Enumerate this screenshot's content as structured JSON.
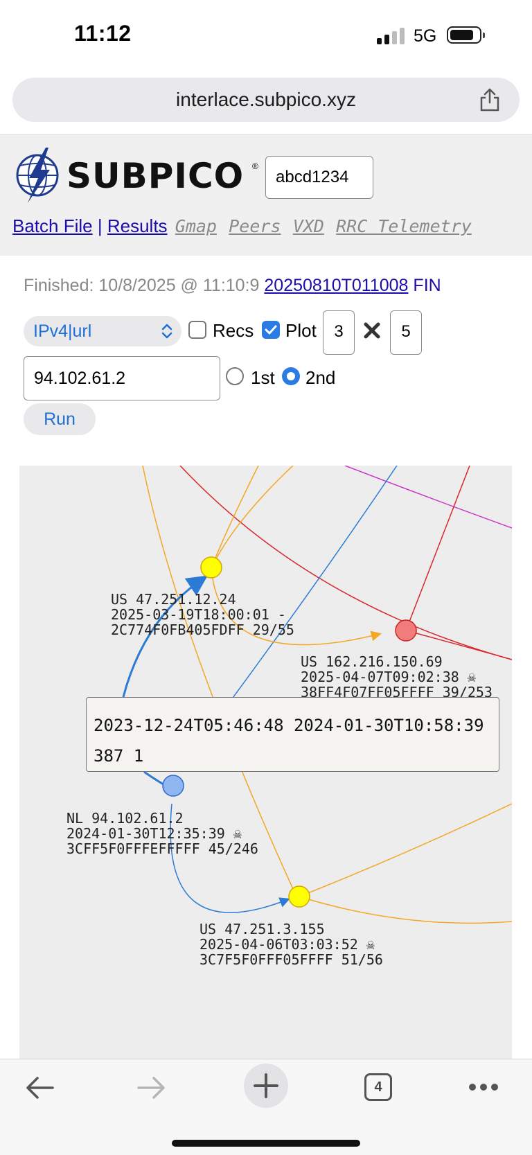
{
  "status_bar": {
    "time": "11:12",
    "network": "5G"
  },
  "browser": {
    "url": "interlace.subpico.xyz",
    "tab_count": "4"
  },
  "header": {
    "logo_text": "SUBPICO",
    "logo_reg": "®",
    "session_id": "abcd1234",
    "nav": {
      "batch_file": "Batch File",
      "separator": "|",
      "results": "Results",
      "gmap": "Gmap",
      "peers": "Peers",
      "vxd": "VXD",
      "rrc_telemetry": "RRC Telemetry"
    }
  },
  "controls": {
    "finished_label": "Finished: 10/8/2025 @ 11:10:9",
    "run_id": "20250810T011008",
    "fin": "FIN",
    "select_value": "IPv4|url",
    "recs_label": "Recs",
    "recs_checked": false,
    "plot_label": "Plot",
    "plot_checked": true,
    "rows": "3",
    "cols": "5",
    "ip_value": "94.102.61.2",
    "radio_1st": "1st",
    "radio_2nd": "2nd",
    "radio_selected": "2nd",
    "run_label": "Run"
  },
  "map": {
    "colors": {
      "yellow_node": "#ffff00",
      "red_node": "#f07c7c",
      "blue_node": "#8fb6f0",
      "orange_line": "#f5a623",
      "red_line": "#d9262e",
      "blue_line": "#2b7bd6",
      "magenta_line": "#cc33cc"
    },
    "nodes": [
      {
        "l1": "US 47.251.12.24",
        "l2": "2025-03-19T18:00:01 -",
        "l3": "2C774F0FB405FDFF 29/55"
      },
      {
        "l1": "US 162.216.150.69",
        "l2": "2025-04-07T09:02:38 ☠",
        "l3": "38FF4F07FF05FFFF 39/253"
      },
      {
        "l1": "NL 94.102.61.2",
        "l2": "2024-01-30T12:35:39 ☠",
        "l3": "3CFF5F0FFFEFFFFF 45/246"
      },
      {
        "l1": "US 47.251.3.155",
        "l2": "2025-04-06T03:03:52 ☠",
        "l3": "3C7F5F0FFF05FFFF 51/56"
      }
    ],
    "tooltip": {
      "line1": "2023-12-24T05:46:48 2024-01-30T10:58:39",
      "line2": "387 1"
    }
  }
}
